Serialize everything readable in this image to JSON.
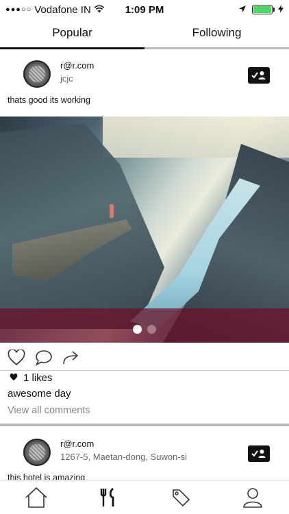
{
  "status_bar": {
    "signal": "●●●○○",
    "carrier": "Vodafone IN",
    "time": "1:09 PM",
    "battery_level": 1.0,
    "battery_color": "#4cd964"
  },
  "tabs": [
    {
      "label": "Popular",
      "active": true
    },
    {
      "label": "Following",
      "active": false
    }
  ],
  "posts": [
    {
      "email": "r@r.com",
      "subtitle": "jcjc",
      "caption": "thats good its working",
      "likes": "1 likes",
      "title": "awesome day",
      "view_comments": "View all comments",
      "carousel_count": 2,
      "carousel_active": 0
    },
    {
      "email": "r@r.com",
      "subtitle": "1267-5, Maetan-dong, Suwon-si",
      "caption": "this hotel is amazing"
    }
  ],
  "icons": {
    "badge": "check-person-icon",
    "like": "heart-outline-icon",
    "comment": "comment-icon",
    "share": "share-arrow-icon",
    "nav": [
      "home-icon",
      "restaurant-icon",
      "tag-icon",
      "profile-icon"
    ]
  },
  "colors": {
    "overlay": "#6e0f28",
    "tab_active": "#111111",
    "tab_inactive": "#bbbbbb"
  }
}
